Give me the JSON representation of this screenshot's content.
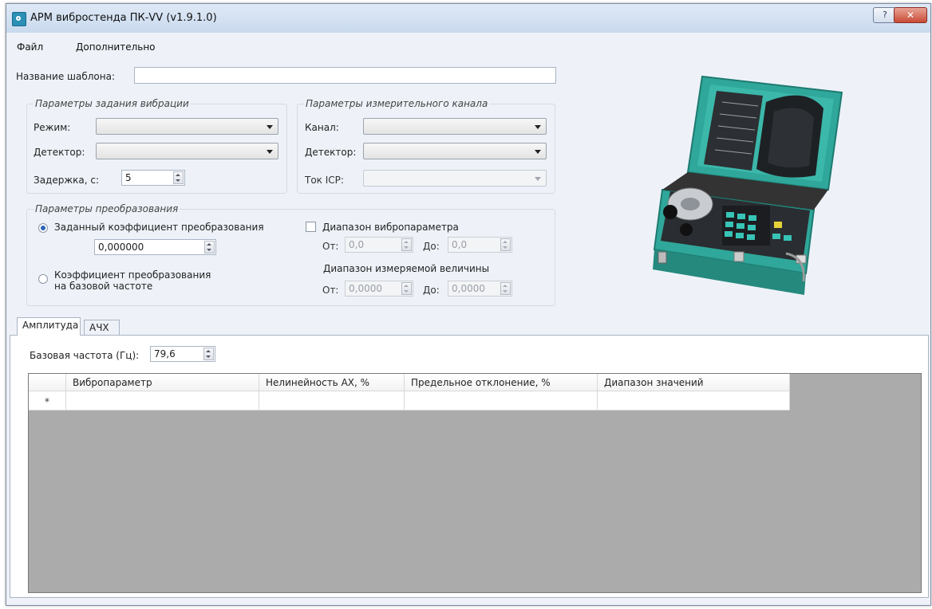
{
  "window": {
    "title": "АРМ вибростенда ПК-VV (v1.9.1.0)",
    "help_label": "?",
    "close_label": "✕"
  },
  "menu": [
    "Файл",
    "Дополнительно"
  ],
  "template": {
    "label": "Название шаблона:",
    "value": ""
  },
  "vibration": {
    "title": "Параметры задания вибрации",
    "mode_label": "Режим:",
    "detector_label": "Детектор:",
    "delay_label": "Задержка, с:",
    "delay_value": "5"
  },
  "channel": {
    "title": "Параметры измерительного канала",
    "channel_label": "Канал:",
    "detector_label": "Детектор:",
    "icp_label": "Ток ICP:"
  },
  "conversion": {
    "title": "Параметры преобразования",
    "option1_label": "Заданный коэффициент преобразования",
    "option1_value": "0,000000",
    "option2_line1": "Коэффициент преобразования",
    "option2_line2": "на базовой частоте"
  },
  "range": {
    "checkbox_label": "Диапазон вибропараметра",
    "from_label": "От:",
    "to_label": "До:",
    "from_value": "0,0",
    "to_value": "0,0",
    "measured_label": "Диапазон измеряемой величины",
    "measured_from_label": "От:",
    "measured_to_label": "До:",
    "measured_from_value": "0,0000",
    "measured_to_value": "0,0000"
  },
  "tabs": [
    "Амплитуда",
    "АЧХ"
  ],
  "base_freq": {
    "label": "Базовая частота (Гц):",
    "value": "79,6"
  },
  "table": {
    "columns": [
      "Вибропараметр",
      "Нелинейность АХ, %",
      "Предельное отклонение, %",
      "Диапазон значений"
    ],
    "new_row_marker": "*"
  },
  "colors": {
    "window_bg": "#eef2f8",
    "grid_bg": "#ababab",
    "device_teal": "#2fa79a",
    "close_red": "#c84b35"
  }
}
